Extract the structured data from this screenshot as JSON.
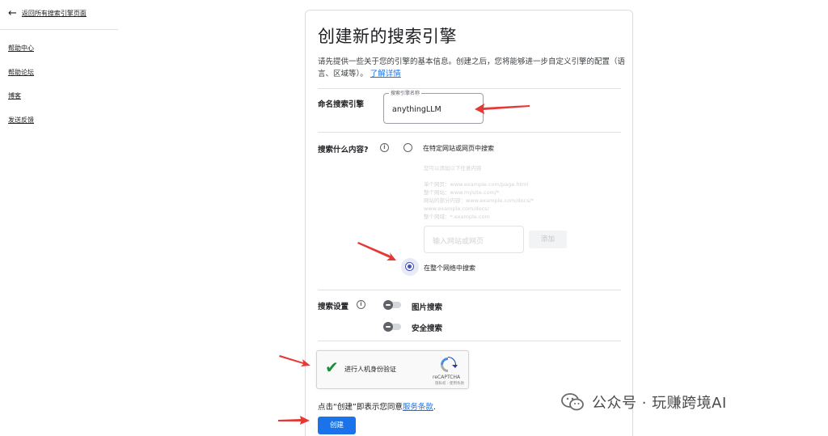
{
  "sidebar": {
    "back_label": "返回所有搜索引擎页面",
    "links": [
      "帮助中心",
      "帮助论坛",
      "博客",
      "发送反馈"
    ]
  },
  "form": {
    "title": "创建新的搜索引擎",
    "description": "请先提供一些关于您的引擎的基本信息。创建之后，您将能够进一步自定义引擎的配置（语言、区域等）。",
    "learn_more": "了解详情",
    "name_section_label": "命名搜索引擎",
    "name_field_label": "搜索引擎名称",
    "name_field_value": "anythingLLM",
    "what_to_search_label": "搜索什么内容?",
    "option_specific_sites": "在特定网站或网页中搜索",
    "faded_hint_lines": [
      "您可以添加以下任意内容",
      "单个网页：www.example.com/page.html",
      "整个网站：www.mysite.com/*",
      "网站的部分内容：www.example.com/docs/*",
      "www.example.com/docs/",
      "整个网域：*.example.com"
    ],
    "site_input_placeholder": "输入网站或网页",
    "add_button": "添加",
    "option_entire_web": "在整个网络中搜索",
    "search_settings_label": "搜索设置",
    "toggle_image_search": "图片搜索",
    "toggle_safe_search": "安全搜索",
    "recaptcha_label": "进行人机身份验证",
    "recaptcha_brand": "reCAPTCHA",
    "recaptcha_terms": "隐私权 - 使用条款",
    "terms_prefix": "点击“创建”即表示您同意",
    "terms_link": "服务条款",
    "terms_suffix": ".",
    "create_button": "创建"
  },
  "state": {
    "selected_search_scope": "option_entire_web",
    "image_search_enabled": false,
    "safe_search_enabled": false,
    "recaptcha_checked": true
  },
  "watermark": {
    "text": "公众号 · 玩赚跨境AI"
  },
  "colors": {
    "accent": "#1a73e8",
    "radio_selected": "#3f51b5",
    "annotation_arrow": "#e53935",
    "check_green": "#1e8e3e"
  }
}
